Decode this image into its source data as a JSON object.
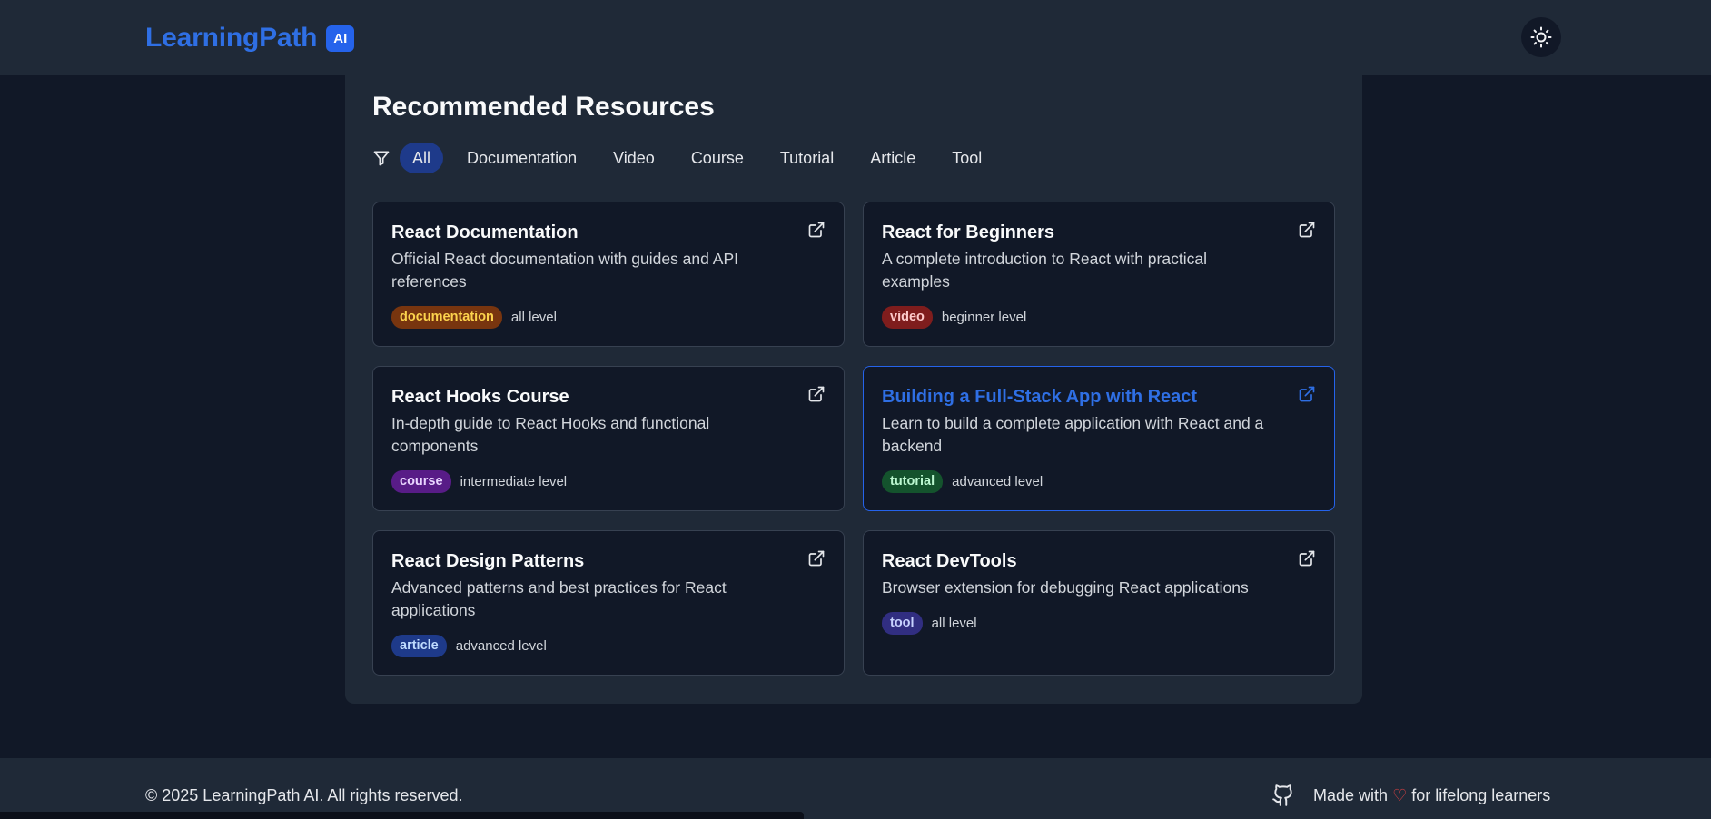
{
  "header": {
    "brand": "LearningPath",
    "badge": "AI",
    "theme_toggle_icon": "sun-icon"
  },
  "main": {
    "title": "Recommended Resources",
    "filter_icon": "filter-icon",
    "filters": [
      {
        "label": "All",
        "active": true
      },
      {
        "label": "Documentation",
        "active": false
      },
      {
        "label": "Video",
        "active": false
      },
      {
        "label": "Course",
        "active": false
      },
      {
        "label": "Tutorial",
        "active": false
      },
      {
        "label": "Article",
        "active": false
      },
      {
        "label": "Tool",
        "active": false
      }
    ],
    "resources": [
      {
        "title": "React Documentation",
        "description": "Official React documentation with guides and API references",
        "type": "documentation",
        "level": "all level",
        "tag_bg": "#78350f",
        "tag_fg": "#fcd34d"
      },
      {
        "title": "React for Beginners",
        "description": "A complete introduction to React with practical examples",
        "type": "video",
        "level": "beginner level",
        "tag_bg": "#7f1d1d",
        "tag_fg": "#fecaca"
      },
      {
        "title": "React Hooks Course",
        "description": "In-depth guide to React Hooks and functional components",
        "type": "course",
        "level": "intermediate level",
        "tag_bg": "#581c87",
        "tag_fg": "#e9d5ff"
      },
      {
        "title": "Building a Full-Stack App with React",
        "description": "Learn to build a complete application with React and a backend",
        "type": "tutorial",
        "level": "advanced level",
        "tag_bg": "#14532d",
        "tag_fg": "#bbf7d0",
        "highlighted": true
      },
      {
        "title": "React Design Patterns",
        "description": "Advanced patterns and best practices for React applications",
        "type": "article",
        "level": "advanced level",
        "tag_bg": "#1e3a8a",
        "tag_fg": "#bfdbfe"
      },
      {
        "title": "React DevTools",
        "description": "Browser extension for debugging React applications",
        "type": "tool",
        "level": "all level",
        "tag_bg": "#312e81",
        "tag_fg": "#c7d2fe"
      }
    ]
  },
  "footer": {
    "copyright": "© 2025 LearningPath AI. All rights reserved.",
    "github_icon": "github-icon",
    "made_with_prefix": "Made with",
    "heart": "♡",
    "made_with_suffix": "for lifelong learners"
  },
  "colors": {
    "accent": "#2563eb",
    "background": "#111827",
    "surface": "#1f2937"
  }
}
